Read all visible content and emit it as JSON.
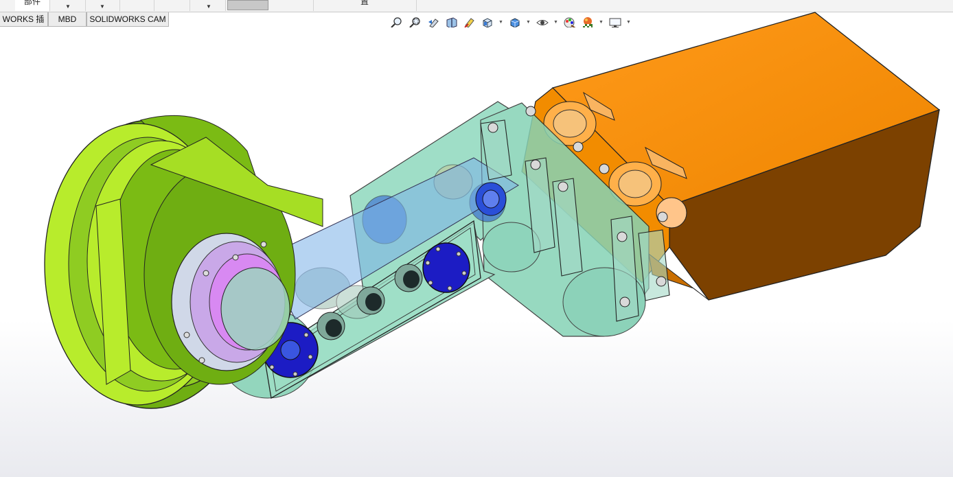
{
  "ribbon": {
    "cells": [
      {
        "label": "部件"
      },
      {
        "label": ""
      },
      {
        "label": ""
      },
      {
        "label": ""
      },
      {
        "label": ""
      },
      {
        "label": ""
      },
      {
        "label": ""
      },
      {
        "label": "置"
      }
    ]
  },
  "tabs": [
    {
      "label": "WORKS 插件"
    },
    {
      "label": "MBD"
    },
    {
      "label": "SOLIDWORKS CAM"
    }
  ],
  "hud": {
    "icons": [
      "zoom-to-fit-icon",
      "zoom-to-area-icon",
      "previous-view-icon",
      "section-view-icon",
      "dynamic-annotation-view-icon",
      "view-orientation-icon",
      "display-style-icon",
      "hide-show-items-icon",
      "edit-appearance-icon",
      "apply-scene-icon",
      "view-settings-icon"
    ]
  },
  "model": {
    "colors": {
      "gearbox": "#8fd9be",
      "pulley": "#7fbf1e",
      "pulley_light": "#b8ec2c",
      "motor": "#f28c00",
      "motor_dark": "#7a4000",
      "flange": "#1a1ac8",
      "shaft_glass": "#7ab0e8"
    }
  }
}
